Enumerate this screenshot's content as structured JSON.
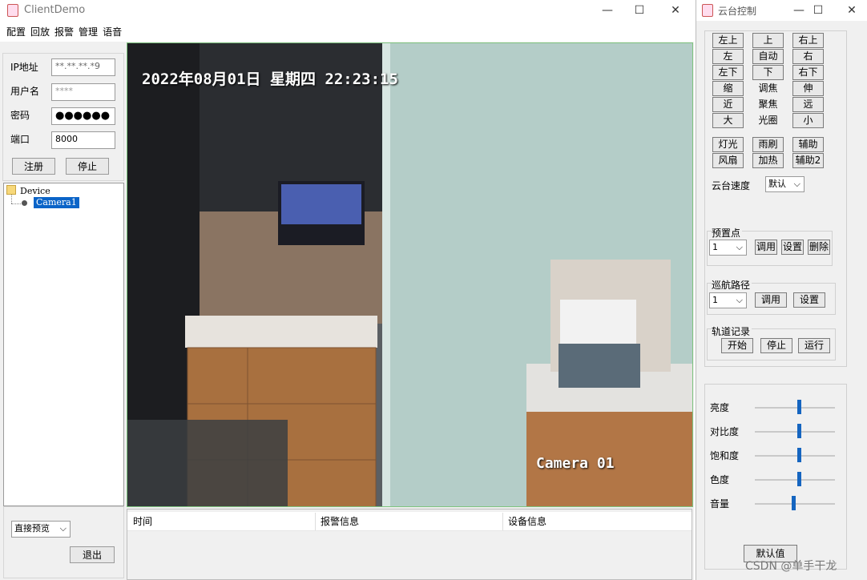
{
  "main_window": {
    "title": "ClientDemo",
    "menu": [
      "配置",
      "回放",
      "报警",
      "管理",
      "语音"
    ],
    "login": {
      "ip_label": "IP地址",
      "ip_value": "**.**.**.*9",
      "user_label": "用户名",
      "user_value": "****",
      "password_label": "密码",
      "password_value": "●●●●●●",
      "port_label": "端口",
      "port_value": "8000",
      "register_button": "注册",
      "stop_button": "停止"
    },
    "device_tree": {
      "root": "Device",
      "child": "Camera1"
    },
    "preview_mode": "直接预览",
    "exit_button": "退出",
    "video": {
      "osd_datetime": "2022年08月01日  星期四  22:23:15",
      "osd_camera": "Camera 01"
    },
    "alarm_table": {
      "columns": [
        "时间",
        "报警信息",
        "设备信息"
      ]
    }
  },
  "ptz_window": {
    "title": "云台控制",
    "direction": {
      "up_left": "左上",
      "up": "上",
      "up_right": "右上",
      "left": "左",
      "auto": "自动",
      "right": "右",
      "down_left": "左下",
      "down": "下",
      "down_right": "右下"
    },
    "lens": {
      "zoom_in": "缩",
      "zoom_label": "调焦",
      "zoom_out": "伸",
      "focus_near": "近",
      "focus_label": "聚焦",
      "focus_far": "远",
      "iris_open": "大",
      "iris_label": "光圈",
      "iris_close": "小"
    },
    "aux": {
      "light": "灯光",
      "wiper": "雨刷",
      "aux1": "辅助",
      "fan": "风扇",
      "heater": "加热",
      "aux2": "辅助2"
    },
    "speed_label": "云台速度",
    "speed_value": "默认",
    "preset": {
      "label": "预置点",
      "value": "1",
      "call": "调用",
      "set": "设置",
      "delete": "删除"
    },
    "cruise": {
      "label": "巡航路径",
      "value": "1",
      "call": "调用",
      "set": "设置"
    },
    "track": {
      "label": "轨道记录",
      "start": "开始",
      "stop": "停止",
      "run": "运行"
    },
    "image": {
      "brightness": "亮度",
      "contrast": "对比度",
      "saturation": "饱和度",
      "hue": "色度",
      "volume": "音量",
      "levels": {
        "brightness": 0.55,
        "contrast": 0.55,
        "saturation": 0.55,
        "hue": 0.55,
        "volume": 0.48
      },
      "default_button": "默认值"
    },
    "watermark": "CSDN @单手干龙"
  }
}
